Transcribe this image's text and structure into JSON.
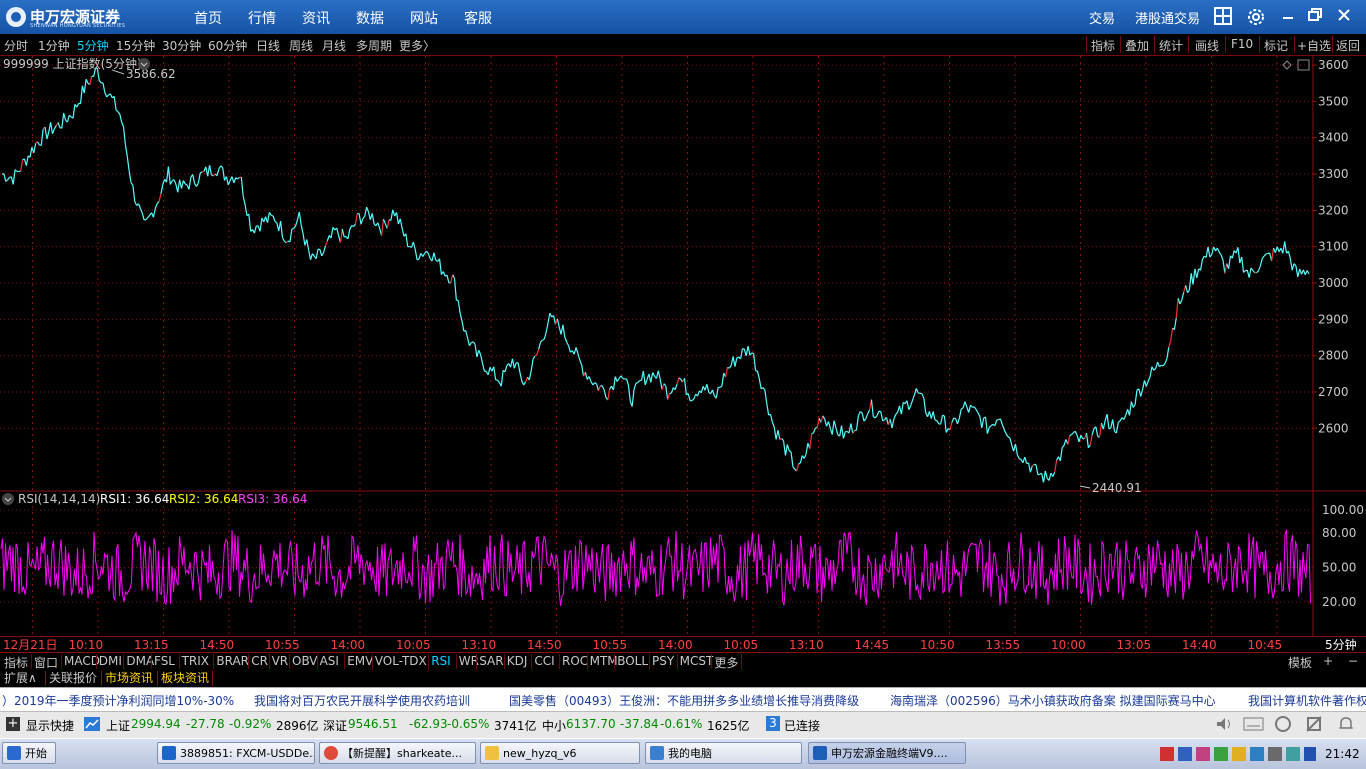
{
  "app": {
    "logo_name": "申万宏源证券",
    "logo_sub": "SHENWAN HONGYUAN SECURITIES",
    "nav": [
      "首页",
      "行情",
      "资讯",
      "数据",
      "网站",
      "客服"
    ],
    "right_links": [
      "交易",
      "港股通交易"
    ],
    "icons": [
      "grid-icon",
      "gear-icon",
      "minimize-icon",
      "restore-icon",
      "close-icon"
    ]
  },
  "periods": [
    "分时",
    "1分钟",
    "5分钟",
    "15分钟",
    "30分钟",
    "60分钟",
    "日线",
    "周线",
    "月线",
    "多周期",
    "更多〉"
  ],
  "active_period": "5分钟",
  "right_tools": [
    "指标",
    "叠加",
    "统计",
    "画线",
    "F10",
    "标记",
    "+自选",
    "返回"
  ],
  "chart_header": "999999 上证指数(5分钟)",
  "chart_data": [
    {
      "type": "candlestick",
      "title": "999999 上证指数(5分钟)",
      "y_ticks": [
        3600,
        3500,
        3400,
        3300,
        3200,
        3100,
        3000,
        2900,
        2800,
        2700,
        2600
      ],
      "ylim": [
        2430,
        3625
      ],
      "annotations": [
        {
          "label": "3586.62",
          "value": 3586.62
        },
        {
          "label": "2440.91",
          "value": 2440.91
        }
      ],
      "series": [
        {
          "values": [
            3300,
            3290,
            3340,
            3390,
            3420,
            3440,
            3470,
            3540,
            3586,
            3520,
            3460,
            3260,
            3150,
            3220,
            3300,
            3260,
            3280,
            3300,
            3320,
            3290,
            3300,
            3150,
            3170,
            3180,
            3120,
            3180,
            3060,
            3080,
            3140,
            3120,
            3180,
            3190,
            3150,
            3200,
            3120,
            3080,
            3090,
            3040,
            3010,
            2860,
            2800,
            2760,
            2730,
            2790,
            2720,
            2800,
            2900,
            2880,
            2820,
            2760,
            2720,
            2700,
            2760,
            2680,
            2740,
            2750,
            2700,
            2740,
            2690,
            2720,
            2680,
            2760,
            2800,
            2820,
            2720,
            2600,
            2540,
            2480,
            2560,
            2640,
            2600,
            2580,
            2620,
            2660,
            2640,
            2620,
            2660,
            2700,
            2640,
            2620,
            2600,
            2660,
            2640,
            2600,
            2640,
            2560,
            2520,
            2480,
            2460,
            2520,
            2580,
            2560,
            2580,
            2620,
            2600,
            2660,
            2720,
            2760,
            2800,
            2940,
            3000,
            3060,
            3100,
            3040,
            3080,
            3020,
            3060,
            3080,
            3100,
            3020,
            3040
          ]
        }
      ]
    },
    {
      "type": "line",
      "title": "RSI(14,14,14)",
      "legend": [
        {
          "name": "RSI1",
          "value": "36.64"
        },
        {
          "name": "RSI2",
          "value": "36.64"
        },
        {
          "name": "RSI3",
          "value": "36.64"
        }
      ],
      "y_ticks": [
        "100.00",
        "80.00",
        "50.00",
        "20.00"
      ],
      "ylim": [
        0,
        100
      ]
    }
  ],
  "time_labels": [
    "12月21日",
    "10:10",
    "13:15",
    "14:50",
    "10:55",
    "14:00",
    "10:05",
    "13:10",
    "14:50",
    "10:55",
    "14:00",
    "10:05",
    "13:10",
    "14:45",
    "10:50",
    "13:55",
    "10:00",
    "13:05",
    "14:40",
    "10:45"
  ],
  "period_label": "5分钟",
  "indicators": [
    "指标",
    "窗口",
    "MACD",
    "DMI",
    "DMA",
    "FSL",
    "TRIX",
    "BRAR",
    "CR",
    "VR",
    "OBV",
    "ASI",
    "EMV",
    "VOL-TDX",
    "RSI",
    "WR",
    "SAR",
    "KDJ",
    "CCI",
    "ROC",
    "MTM",
    "BOLL",
    "PSY",
    "MCST",
    "更多"
  ],
  "active_indicator": "RSI",
  "ind_right": [
    "模板",
    "+",
    "−"
  ],
  "bottom_tabs": [
    "扩展∧",
    "关联报价",
    "市场资讯",
    "板块资讯"
  ],
  "news": [
    "）2019年一季度预计净利润同增10%-30%",
    "我国将对百万农民开展科学使用农药培训",
    "国美零售（00493）王俊洲：不能用拼多多业绩增长推导消费降级",
    "海南瑞泽（002596）马术小镇获政府备案 拟建国际赛马中心",
    "我国计算机软件著作权"
  ],
  "status": {
    "show_shortcut": "显示快捷",
    "sh": {
      "name": "上证",
      "price": "2994.94",
      "chg": "-27.78",
      "pct": "-0.92%",
      "vol": "2896亿"
    },
    "sz": {
      "name": "深证",
      "price": "9546.51",
      "chg": "-62.93",
      "pct": "-0.65%",
      "vol": "3741亿"
    },
    "zx": {
      "name": "中小",
      "price": "6137.70",
      "chg": "-37.84",
      "pct": "-0.61%",
      "vol": "1625亿"
    },
    "conn_count": "3",
    "conn_label": "已连接"
  },
  "taskbar": {
    "start": "开始",
    "items": [
      "3889851: FXCM-USDDe...",
      "【新提醒】sharkeate...",
      "new_hyzq_v6",
      "我的电脑",
      "申万宏源金融终端V9...."
    ],
    "clock": "21:42"
  },
  "colors": {
    "up": "#ff3030",
    "down": "#54ffff",
    "rsi": "#ff00ff",
    "grid": "#8a1010",
    "titlebar": "#1d5fb6",
    "active": "#00d8ff"
  }
}
